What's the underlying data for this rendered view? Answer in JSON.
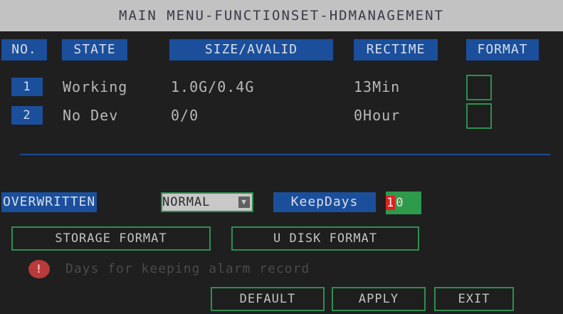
{
  "title": "MAIN MENU-FUNCTIONSET-HDMANAGEMENT",
  "table": {
    "headers": [
      "NO.",
      "STATE",
      "SIZE/AVALID",
      "RECTIME",
      "FORMAT"
    ],
    "rows": [
      {
        "no": "1",
        "state": "Working",
        "size": "1.0G/0.4G",
        "rectime": "13Min",
        "format_checked": false
      },
      {
        "no": "2",
        "state": "No Dev",
        "size": "0/0",
        "rectime": "0Hour",
        "format_checked": false
      }
    ]
  },
  "overwrite": {
    "label": "OVERWRITTEN",
    "value": "NORMAL"
  },
  "keepdays": {
    "label": "KeepDays",
    "digit1": "1",
    "digit2": "0"
  },
  "buttons": {
    "storage_format": "STORAGE FORMAT",
    "u_disk_format": "U DISK FORMAT",
    "default": "DEFAULT",
    "apply": "APPLY",
    "exit": "EXIT"
  },
  "hint": {
    "icon": "alert-icon",
    "icon_glyph": "!",
    "text": "Days for keeping alarm record"
  },
  "colors": {
    "title_bg": "#c2c2c2",
    "header_bg": "#1b4f9c",
    "border_green": "#2f8e4f",
    "keepdays_bg": "#2e9a4c",
    "digit_red": "#e0201f"
  }
}
